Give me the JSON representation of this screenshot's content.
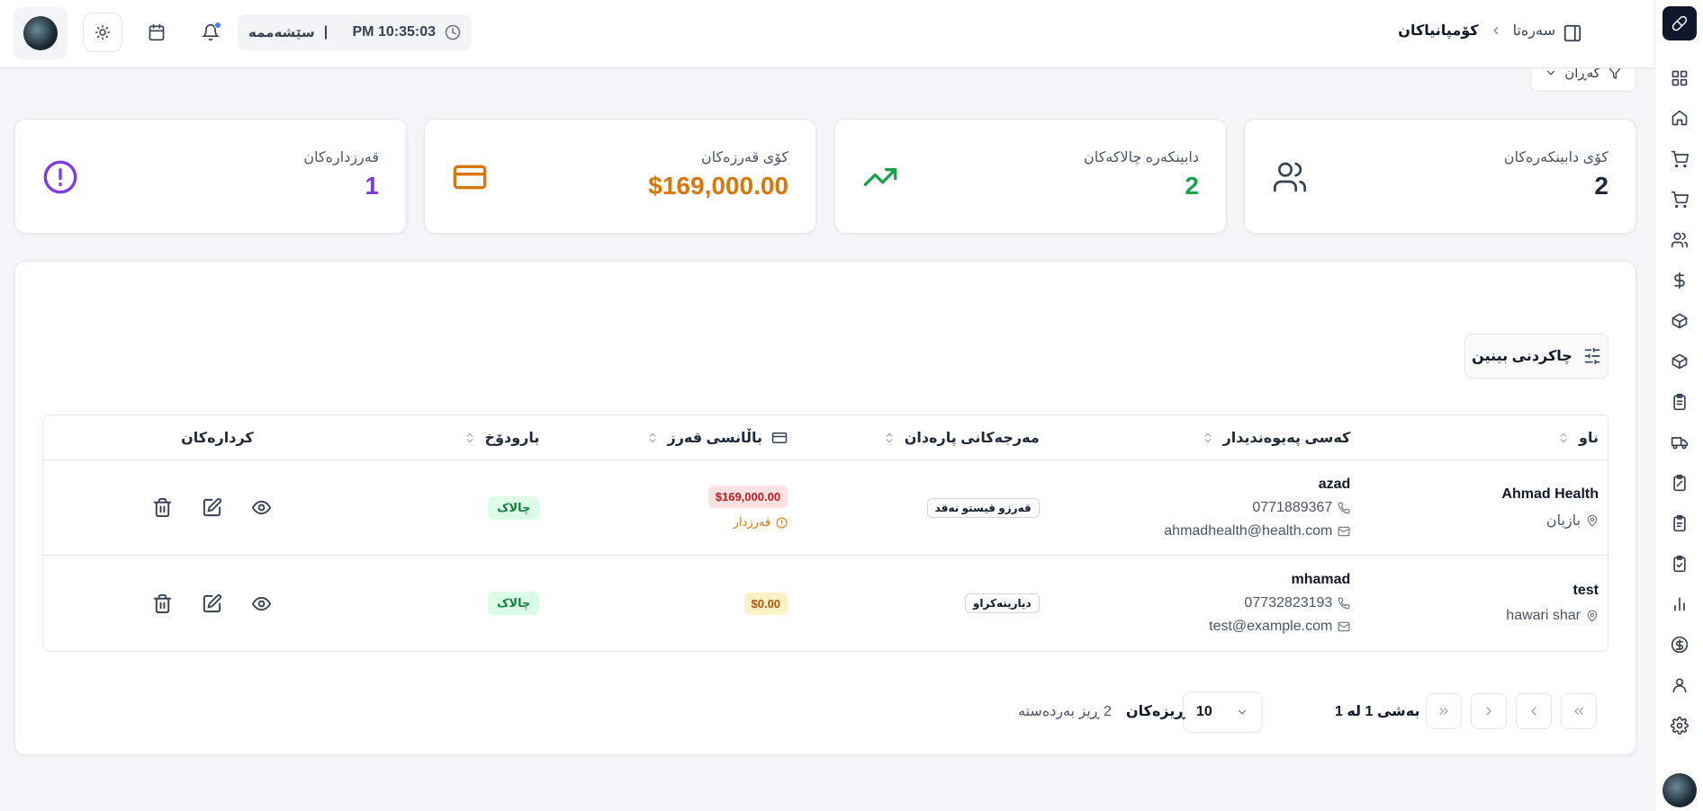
{
  "header": {
    "breadcrumb_root": "سەرەتا",
    "breadcrumb_current": "کۆمپانیاکان",
    "day": "سێشەممە",
    "separator": "|",
    "time": "PM 10:35:03"
  },
  "filter": {
    "label": "گەڕان"
  },
  "stats": [
    {
      "label": "کۆی دابینکەرەکان",
      "value": "2",
      "color": "#1f2937",
      "icon": "users-icon"
    },
    {
      "label": "دابینکەرە چالاکەکان",
      "value": "2",
      "color": "#16a34a",
      "icon": "trending-up-icon"
    },
    {
      "label": "کۆی قەرزەکان",
      "value": "$169,000.00",
      "color": "#d97706",
      "icon": "credit-card-icon"
    },
    {
      "label": "قەرزدارەکان",
      "value": "1",
      "color": "#7c3aed",
      "icon": "alert-circle-icon"
    }
  ],
  "toolbar": {
    "columns_label": "چاکردنی بینین"
  },
  "table": {
    "headers": [
      "ناو",
      "کەسی پەیوەندیدار",
      "مەرجەکانی پارەدان",
      "باڵانسی قەرز",
      "بارودۆخ",
      "کردارەکان"
    ],
    "rows": [
      {
        "name": "Ahmad Health",
        "location": "بازیان",
        "contact": "azad",
        "phone": "0771889367",
        "email": "ahmadhealth@health.com",
        "terms": "قەرزو قیستو نەقد",
        "balance": "$169,000.00",
        "debt_label": "قەرزدار",
        "status": "چالاک"
      },
      {
        "name": "test",
        "location": "hawari shar",
        "contact": "mhamad",
        "phone": "07732823193",
        "email": "test@example.com",
        "terms": "دیارینەکراو",
        "balance": "$0.00",
        "debt_label": "",
        "status": "چالاک"
      }
    ]
  },
  "pagination": {
    "page_info": "بەشی 1 لە 1",
    "rows_label": "ڕیزەکان",
    "rows_per_page": "10",
    "total": "2 ڕیز بەردەستە"
  },
  "colors": {
    "accent": "#0f172a",
    "notification": "#3b82f6"
  }
}
